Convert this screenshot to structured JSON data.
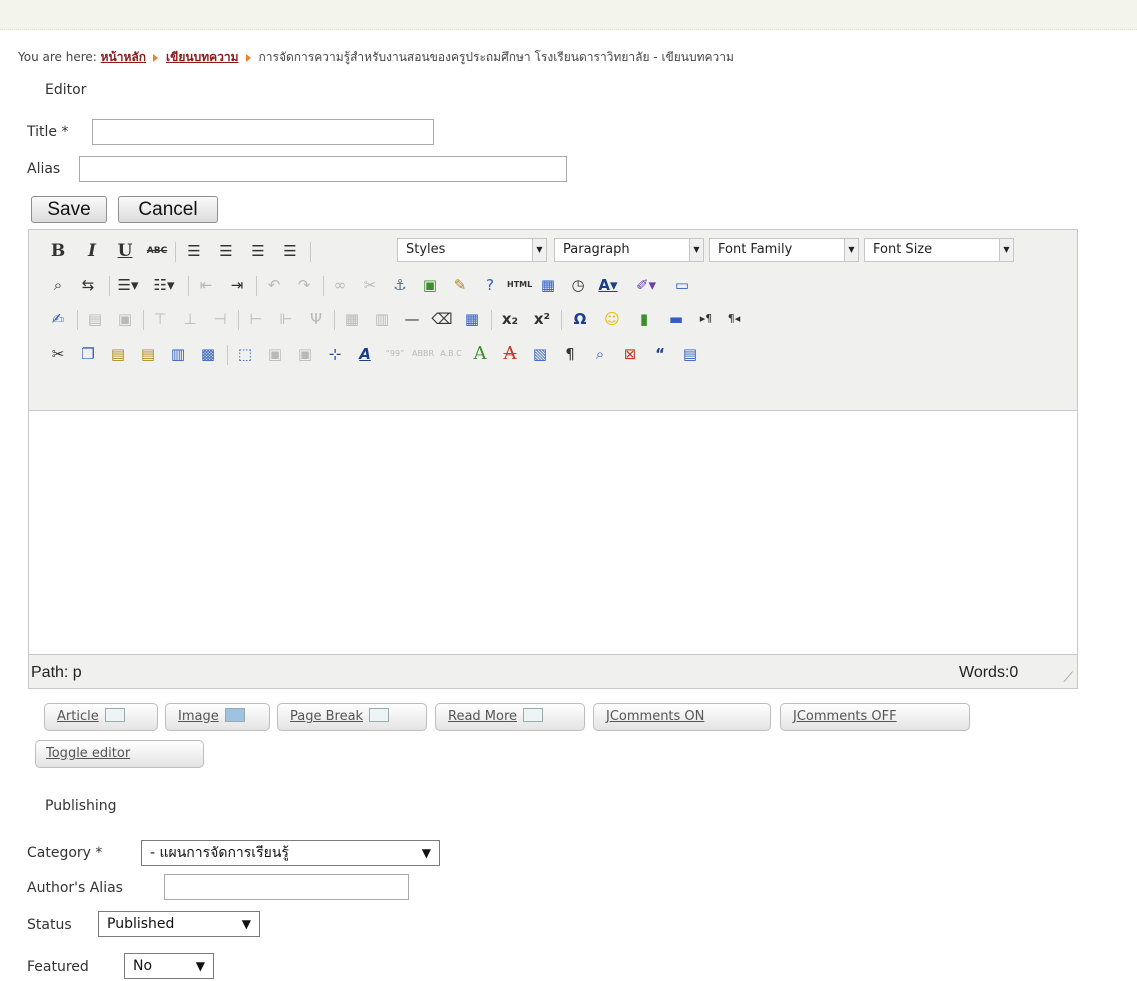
{
  "breadcrumb": {
    "prefix": "You are here:",
    "link1": "หน้าหลัก",
    "link2": "เขียนบทความ",
    "current": "การจัดการความรู้สำหรับงานสอนของครูประถมศึกษา โรงเรียนดาราวิทยาลัย - เขียนบทความ"
  },
  "editor_section": {
    "legend": "Editor",
    "title_label": "Title *",
    "alias_label": "Alias",
    "title_value": "",
    "alias_value": "",
    "save_label": "Save",
    "cancel_label": "Cancel"
  },
  "toolbar": {
    "row1": [
      "B",
      "I",
      "U",
      "ABC"
    ],
    "styles": "Styles",
    "paragraph": "Paragraph",
    "font_family": "Font Family",
    "font_size": "Font Size"
  },
  "statusbar": {
    "path": "Path: p",
    "words": "Words:0"
  },
  "buttons": {
    "article": "Article",
    "image": "Image",
    "page_break": "Page Break",
    "read_more": "Read More",
    "jcomments_on": "JComments ON",
    "jcomments_off": "JComments OFF",
    "toggle_editor": "Toggle editor"
  },
  "publishing": {
    "legend": "Publishing",
    "category_label": "Category *",
    "category_value": "- แผนการจัดการเรียนรู้",
    "author_alias_label": "Author's Alias",
    "author_alias_value": "",
    "status_label": "Status",
    "status_value": "Published",
    "featured_label": "Featured",
    "featured_value": "No"
  }
}
